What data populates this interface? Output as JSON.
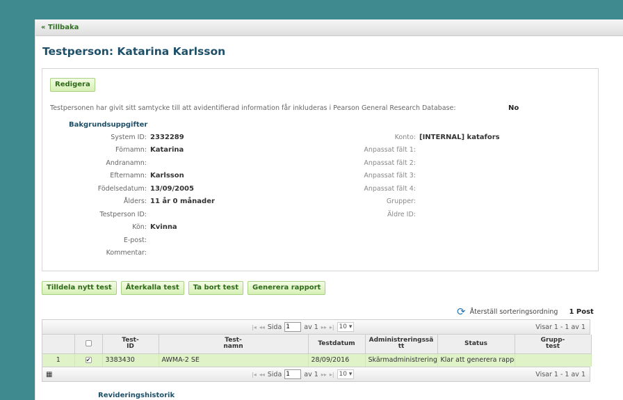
{
  "nav": {
    "back_label": "« Tillbaka"
  },
  "page_title": "Testperson: Katarina Karlsson",
  "edit_label": "Redigera",
  "consent": {
    "text": "Testpersonen har givit sitt samtycke till att avidentifierad information får inkluderas i Pearson General Research Database:",
    "value": "No"
  },
  "section_title": "Bakgrundsuppgifter",
  "left_fields": [
    {
      "label": "System ID:",
      "value": "2332289"
    },
    {
      "label": "Förnamn:",
      "value": "Katarina"
    },
    {
      "label": "Andranamn:",
      "value": ""
    },
    {
      "label": "Efternamn:",
      "value": "Karlsson"
    },
    {
      "label": "Födelsedatum:",
      "value": "13/09/2005"
    },
    {
      "label": "Ålders:",
      "value": "11 år 0 månader"
    },
    {
      "label": "Testperson ID:",
      "value": ""
    },
    {
      "label": "Kön:",
      "value": "Kvinna"
    },
    {
      "label": "E-post:",
      "value": ""
    },
    {
      "label": "Kommentar:",
      "value": ""
    }
  ],
  "right_fields": [
    {
      "label": "Konto:",
      "value": "[INTERNAL] katafors"
    },
    {
      "label": "Anpassat fält 1:",
      "value": ""
    },
    {
      "label": "Anpassat fält 2:",
      "value": ""
    },
    {
      "label": "Anpassat fält 3:",
      "value": ""
    },
    {
      "label": "Anpassat fält 4:",
      "value": ""
    },
    {
      "label": "Grupper:",
      "value": ""
    },
    {
      "label": "Äldre ID:",
      "value": ""
    }
  ],
  "actions": [
    "Tilldela nytt test",
    "Återkalla test",
    "Ta bort test",
    "Generera rapport"
  ],
  "reset_sort_label": "Återställ sorteringsordning",
  "post_count": "1 Post",
  "pager": {
    "page_label": "Sida",
    "page_value": "1",
    "of_label": "av 1",
    "page_size": "10",
    "view_text": "Visar 1 - 1 av 1"
  },
  "table": {
    "headers": [
      "",
      "",
      "Test-\nID",
      "Test-\nnamn",
      "Testdatum",
      "Administreringssä\ntt",
      "Status",
      "Grupp-\ntest"
    ],
    "rows": [
      {
        "num": "1",
        "checked": "✔",
        "test_id": "3383430",
        "test_name": "AWMA-2 SE",
        "date": "28/09/2016",
        "admin": "Skärmadministrering",
        "status": "Klar att generera rapport",
        "group": ""
      }
    ]
  },
  "history_title": "Revideringshistorik"
}
